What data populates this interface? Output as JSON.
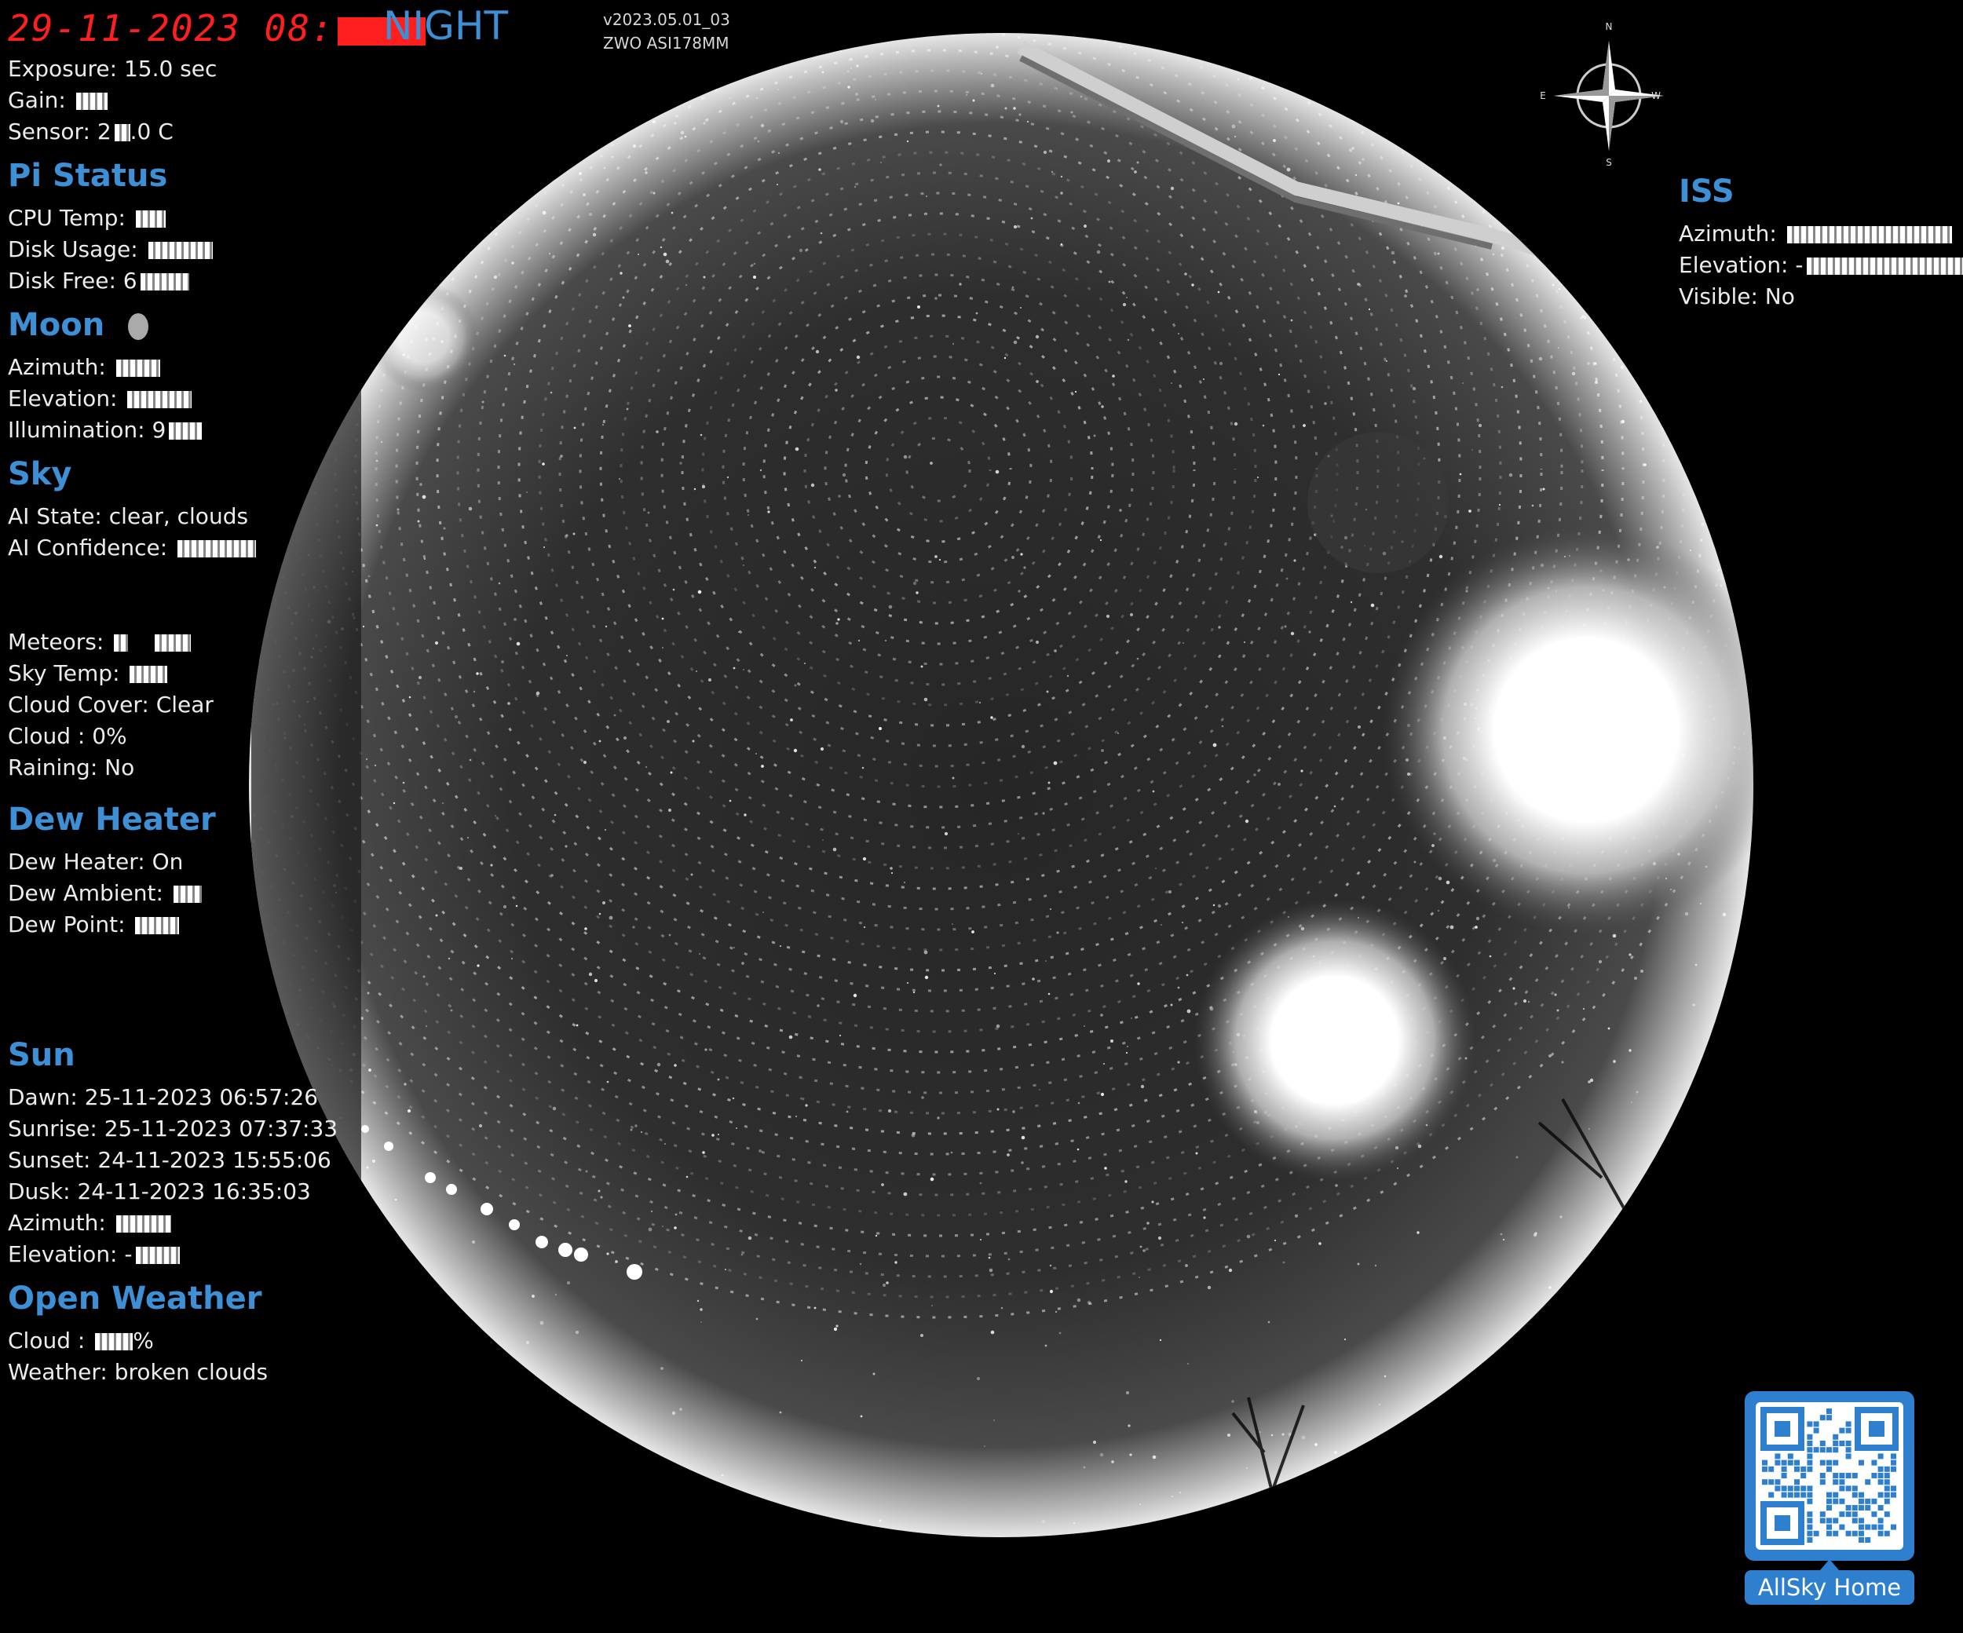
{
  "overlay": {
    "date_text": "29-11-2023",
    "time_prefix": "08:",
    "mode": "NIGHT",
    "version": "v2023.05.01_03",
    "camera_model": "ZWO ASI178MM",
    "exposure": "Exposure: 15.0 sec",
    "gain_label": "Gain: ",
    "sensor_label": "Sensor: 2",
    "sensor_suffix": ".0 C"
  },
  "pi_status": {
    "heading": "Pi Status",
    "cpu_temp_label": "CPU Temp: ",
    "disk_usage_label": "Disk Usage: ",
    "disk_free_label": "Disk Free: 6"
  },
  "moon": {
    "heading": "Moon",
    "azimuth_label": "Azimuth: ",
    "elevation_label": "Elevation: ",
    "illumination_label": "Illumination: 9"
  },
  "sky": {
    "heading": "Sky",
    "ai_state_label": "AI State: ",
    "ai_state_value": "clear, clouds",
    "ai_confidence_label": "AI Confidence: "
  },
  "conditions": {
    "meteors_label": "Meteors: ",
    "sky_temp_label": "Sky Temp: ",
    "cloud_cover": "Cloud Cover: Clear",
    "cloud": "Cloud : 0%",
    "raining": "Raining: No"
  },
  "dew_heater": {
    "heading": "Dew Heater",
    "state": "Dew Heater: On",
    "ambient_label": "Dew Ambient: ",
    "point_label": "Dew Point: "
  },
  "sun": {
    "heading": "Sun",
    "dawn": "Dawn: 25-11-2023 06:57:26",
    "sunrise": "Sunrise: 25-11-2023 07:37:33",
    "sunset": "Sunset: 24-11-2023 15:55:06",
    "dusk": "Dusk: 24-11-2023 16:35:03",
    "azimuth_label": "Azimuth: ",
    "elevation_label": "Elevation: -"
  },
  "open_weather": {
    "heading": "Open Weather",
    "cloud_label": "Cloud : ",
    "cloud_suffix": "%",
    "weather_label": "Weather: ",
    "weather_value": "broken clouds"
  },
  "iss": {
    "heading": "ISS",
    "azimuth_label": "Azimuth: ",
    "elevation_label": "Elevation: -",
    "visible": "Visible: No"
  },
  "compass": {
    "n": "N",
    "s": "S",
    "e": "E",
    "w": "W",
    "icon": "compass-rose-icon"
  },
  "qr": {
    "button_label": "AllSky Home",
    "icon": "qr-code-icon"
  },
  "colors": {
    "date_red": "#ff1f1f",
    "accent_blue": "#3d8fd6",
    "button_blue": "#2f7fcf"
  }
}
